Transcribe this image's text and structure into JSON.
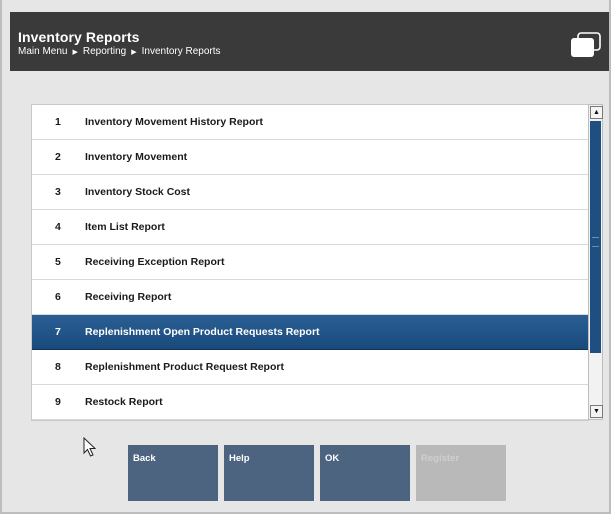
{
  "header": {
    "title": "Inventory Reports",
    "breadcrumb": [
      "Main Menu",
      "Reporting",
      "Inventory Reports"
    ]
  },
  "report_list": {
    "items": [
      {
        "num": "1",
        "label": "Inventory Movement History Report"
      },
      {
        "num": "2",
        "label": "Inventory Movement"
      },
      {
        "num": "3",
        "label": "Inventory Stock Cost"
      },
      {
        "num": "4",
        "label": "Item List Report"
      },
      {
        "num": "5",
        "label": "Receiving Exception Report"
      },
      {
        "num": "6",
        "label": "Receiving Report"
      },
      {
        "num": "7",
        "label": "Replenishment Open Product Requests Report",
        "selected": true
      },
      {
        "num": "8",
        "label": "Replenishment Product Request Report"
      },
      {
        "num": "9",
        "label": "Restock Report"
      }
    ]
  },
  "buttons": {
    "back": "Back",
    "help": "Help",
    "ok": "OK",
    "register": "Register"
  },
  "colors": {
    "header_bg": "#3a3a3a",
    "selected_row": "#1f4f81",
    "button_bg": "#4d6480",
    "button_disabled": "#b9b9b9"
  },
  "icons": {
    "window": "window-stack-icon",
    "scroll_up": "triangle-up-icon",
    "scroll_down": "triangle-down-icon",
    "cursor": "mouse-pointer-icon"
  }
}
